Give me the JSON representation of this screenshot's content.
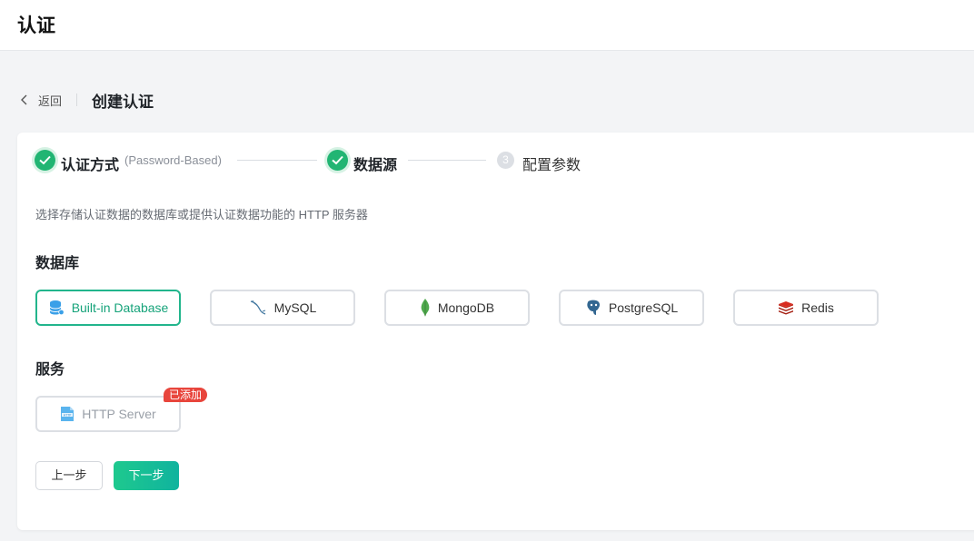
{
  "header": {
    "title": "认证"
  },
  "breadcrumb": {
    "back_label": "返回",
    "page_title": "创建认证"
  },
  "steps": [
    {
      "label": "认证方式",
      "sub": "(Password-Based)",
      "status": "done"
    },
    {
      "label": "数据源",
      "status": "done"
    },
    {
      "label": "配置参数",
      "number": "3",
      "status": "pending"
    }
  ],
  "description": "选择存储认证数据的数据库或提供认证数据功能的 HTTP 服务器",
  "database": {
    "title": "数据库",
    "options": [
      {
        "label": "Built-in Database",
        "icon": "database-icon",
        "selected": true
      },
      {
        "label": "MySQL",
        "icon": "mysql-icon"
      },
      {
        "label": "MongoDB",
        "icon": "mongodb-icon"
      },
      {
        "label": "PostgreSQL",
        "icon": "postgresql-icon"
      },
      {
        "label": "Redis",
        "icon": "redis-icon"
      }
    ]
  },
  "service": {
    "title": "服务",
    "options": [
      {
        "label": "HTTP Server",
        "icon": "http-icon",
        "disabled": true,
        "badge": "已添加"
      }
    ]
  },
  "actions": {
    "prev_label": "上一步",
    "next_label": "下一步"
  },
  "colors": {
    "accent": "#22b573",
    "badge": "#e8453c",
    "selected_border": "#22b58c"
  }
}
